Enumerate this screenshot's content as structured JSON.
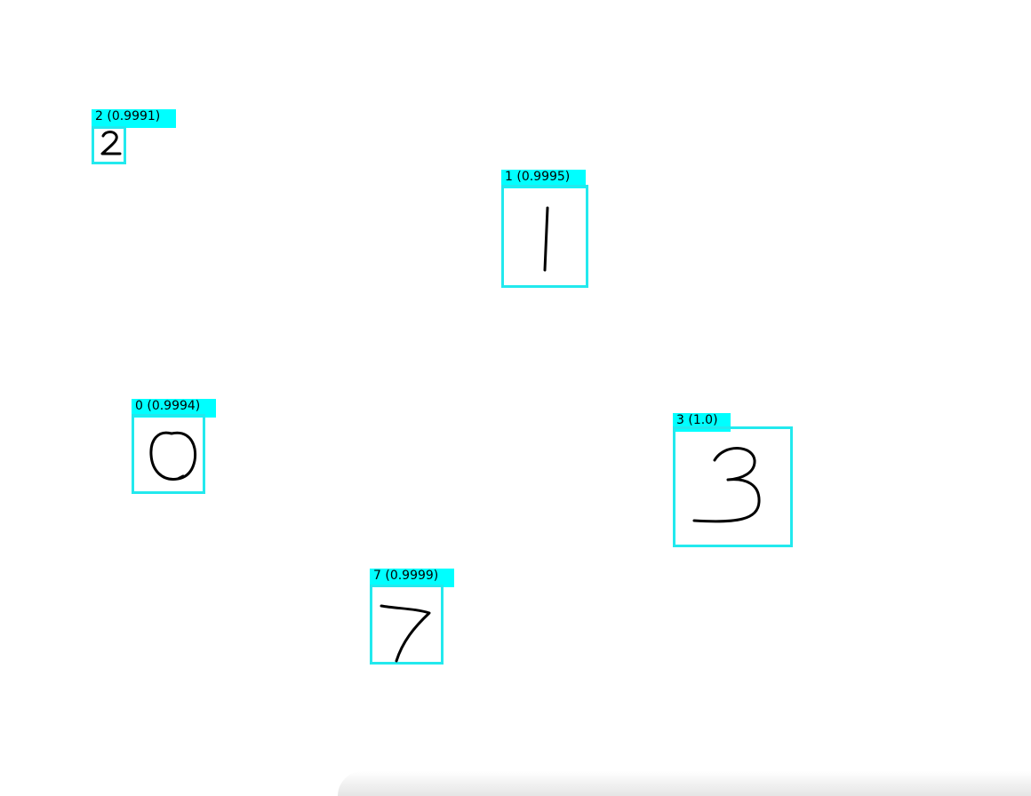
{
  "detections": [
    {
      "label": "2 (0.9991)",
      "digit": "2"
    },
    {
      "label": "1 (0.9995)",
      "digit": "1"
    },
    {
      "label": "0 (0.9994)",
      "digit": "0"
    },
    {
      "label": "3 (1.0)",
      "digit": "3"
    },
    {
      "label": "7 (0.9999)",
      "digit": "7"
    }
  ],
  "colors": {
    "box_border": "#22e9ee",
    "label_background": "#00ffff",
    "label_text": "#000000",
    "stroke": "#000000",
    "canvas_background": "#ffffff"
  }
}
